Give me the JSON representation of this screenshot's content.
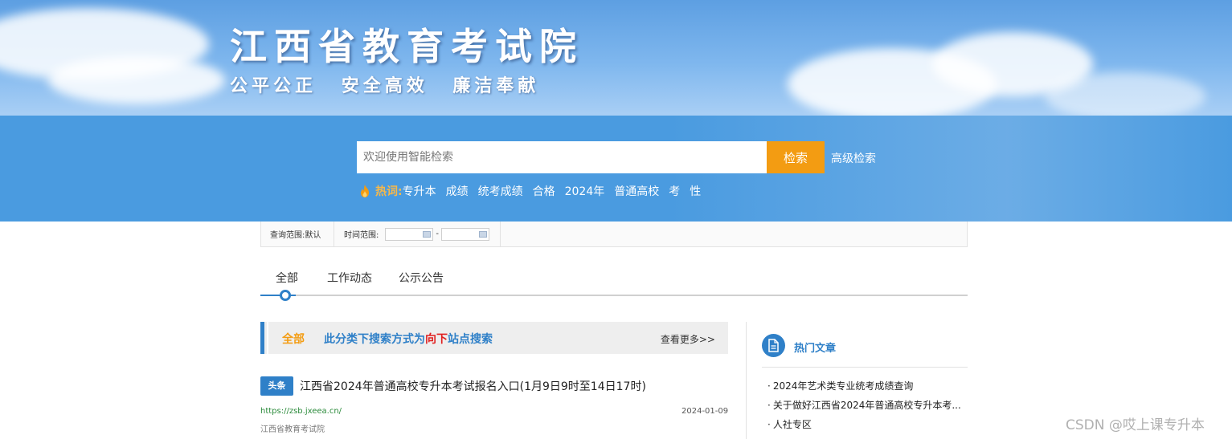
{
  "banner": {
    "title": "江西省教育考试院",
    "slogan": [
      "公平公正",
      "安全高效",
      "廉洁奉献"
    ]
  },
  "search": {
    "placeholder": "欢迎使用智能检索",
    "button_label": "检索",
    "advanced_label": "高级检索",
    "hot_label": "热词:",
    "hot_terms": [
      "专升本",
      "成绩",
      "统考成绩",
      "合格",
      "2024年",
      "普通高校",
      "考",
      "性"
    ]
  },
  "filters": {
    "scope_label": "查询范围:",
    "scope_value": "默认",
    "time_label": "时间范围:",
    "time_sep": "-"
  },
  "tabs": [
    "全部",
    "工作动态",
    "公示公告"
  ],
  "category": {
    "name": "全部",
    "hint_prefix": "此分类下搜索方式为",
    "hint_highlight": "向下",
    "hint_suffix": "站点搜索",
    "more_label": "查看更多>>"
  },
  "article": {
    "badge": "头条",
    "title": "江西省2024年普通高校专升本考试报名入口(1月9日9时至14日17时)",
    "url": "https://zsb.jxeea.cn/",
    "date": "2024-01-09",
    "source": "江西省教育考试院"
  },
  "sidebar": {
    "title": "热门文章",
    "items": [
      "2024年艺术类专业统考成绩查询",
      "关于做好江西省2024年普通高校专升本考...",
      "人社专区"
    ]
  },
  "watermark": "CSDN @哎上课专升本",
  "colors": {
    "primary": "#2f80c8",
    "accent": "#f39c12",
    "band": "#4a9be0",
    "highlight": "#e02020"
  }
}
